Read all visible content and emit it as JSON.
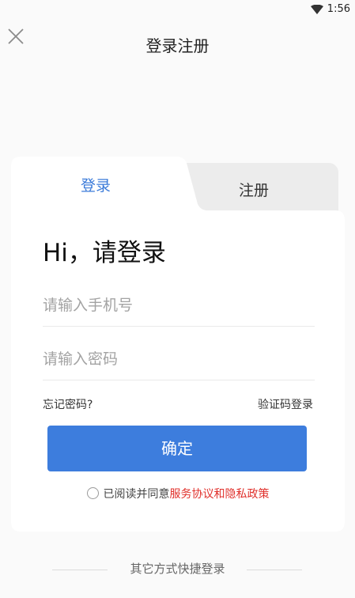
{
  "status_bar": {
    "time": "1:56",
    "wifi_icon": "wifi-icon"
  },
  "header": {
    "title": "登录注册",
    "close_icon": "close-icon"
  },
  "tabs": {
    "login": "登录",
    "register": "注册"
  },
  "form": {
    "greeting": "Hi，请登录",
    "phone_placeholder": "请输入手机号",
    "phone_value": "",
    "password_placeholder": "请输入密码",
    "password_value": "",
    "forgot_password": "忘记密码?",
    "code_login": "验证码登录",
    "confirm_button": "确定"
  },
  "agreement": {
    "prefix": "已阅读并同意",
    "link": "服务协议和隐私政策",
    "checked": false
  },
  "other_login": {
    "label": "其它方式快捷登录"
  },
  "colors": {
    "accent": "#3d7ddd",
    "tab_active_text": "#3b7bd9",
    "link_red": "#e0302b",
    "background": "#fafafa"
  }
}
